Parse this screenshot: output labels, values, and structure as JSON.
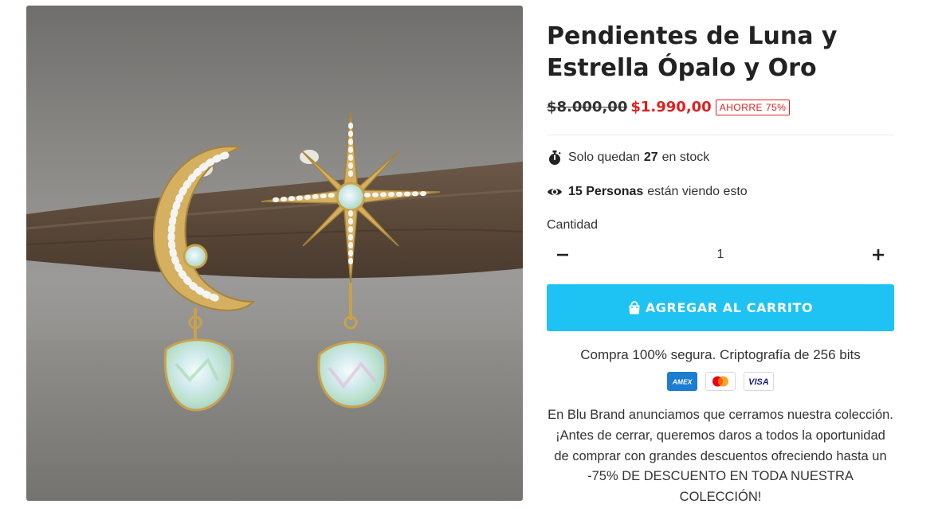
{
  "product": {
    "title": "Pendientes de Luna y Estrella Ópalo y Oro",
    "image_alt": "Pendientes de luna y estrella con ópalo y oro"
  },
  "price": {
    "old": "$8.000,00",
    "new": "$1.990,00",
    "badge": "AHORRE 75%"
  },
  "stock": {
    "icon": "stopwatch-icon",
    "prefix": "Solo quedan",
    "count": "27",
    "suffix": "en stock"
  },
  "viewers": {
    "icon": "eye-icon",
    "count": "15 Personas",
    "suffix": "están viendo esto"
  },
  "quantity": {
    "label": "Cantidad",
    "value": "1",
    "minus": "−",
    "plus": "+"
  },
  "cart": {
    "icon": "shopping-bag-icon",
    "label": "AGREGAR AL CARRITO",
    "color": "#1ec3f4"
  },
  "security": {
    "text": "Compra 100% segura. Criptografía de 256 bits",
    "cards": [
      "AMEX",
      "mastercard",
      "VISA"
    ]
  },
  "description": "En Blu Brand anunciamos que cerramos nuestra colección. ¡Antes de cerrar, queremos daros a todos la oportunidad de comprar con grandes descuentos ofreciendo hasta un -75% DE DESCUENTO EN TODA NUESTRA COLECCIÓN!",
  "colors": {
    "sale_red": "#e0201f",
    "text": "#222222",
    "gold": "#c9a14a",
    "opal": "#d9eef0"
  }
}
